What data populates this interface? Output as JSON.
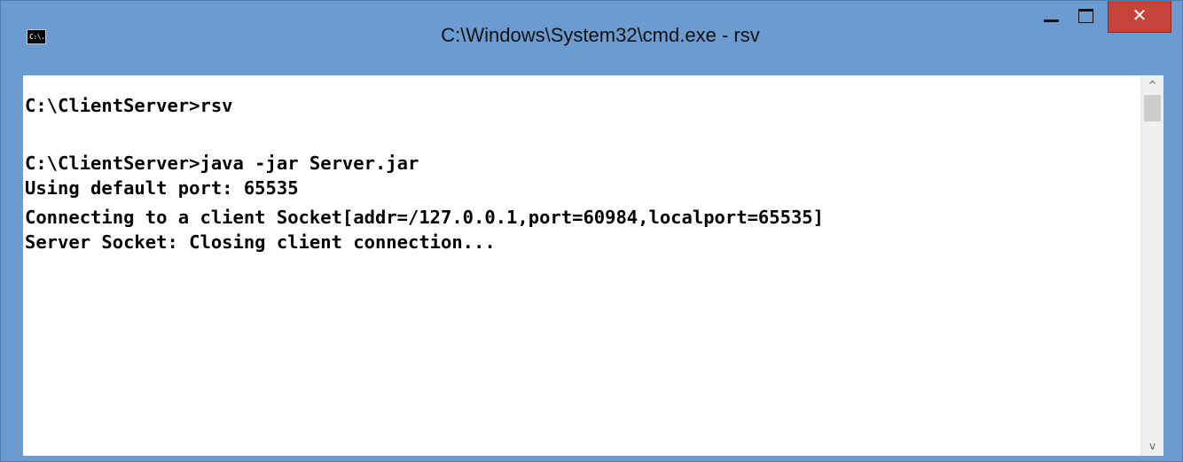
{
  "window": {
    "title": "C:\\Windows\\System32\\cmd.exe - rsv",
    "icon": "cmd-icon",
    "icon_glyph": "C:\\.",
    "frame_color": "#6b9bd1",
    "close_color": "#c7443b"
  },
  "controls": {
    "minimize_icon": "minimize-icon",
    "maximize_icon": "maximize-icon",
    "close_icon": "close-icon",
    "close_glyph": "✕"
  },
  "console": {
    "lines": [
      "C:\\ClientServer>rsv",
      "",
      "C:\\ClientServer>java -jar Server.jar",
      "Using default port: 65535",
      "Connecting to a client Socket[addr=/127.0.0.1,port=60984,localport=65535]",
      "Server Socket: Closing client connection..."
    ]
  },
  "scrollbar": {
    "up_glyph": "^",
    "down_glyph": "v"
  }
}
